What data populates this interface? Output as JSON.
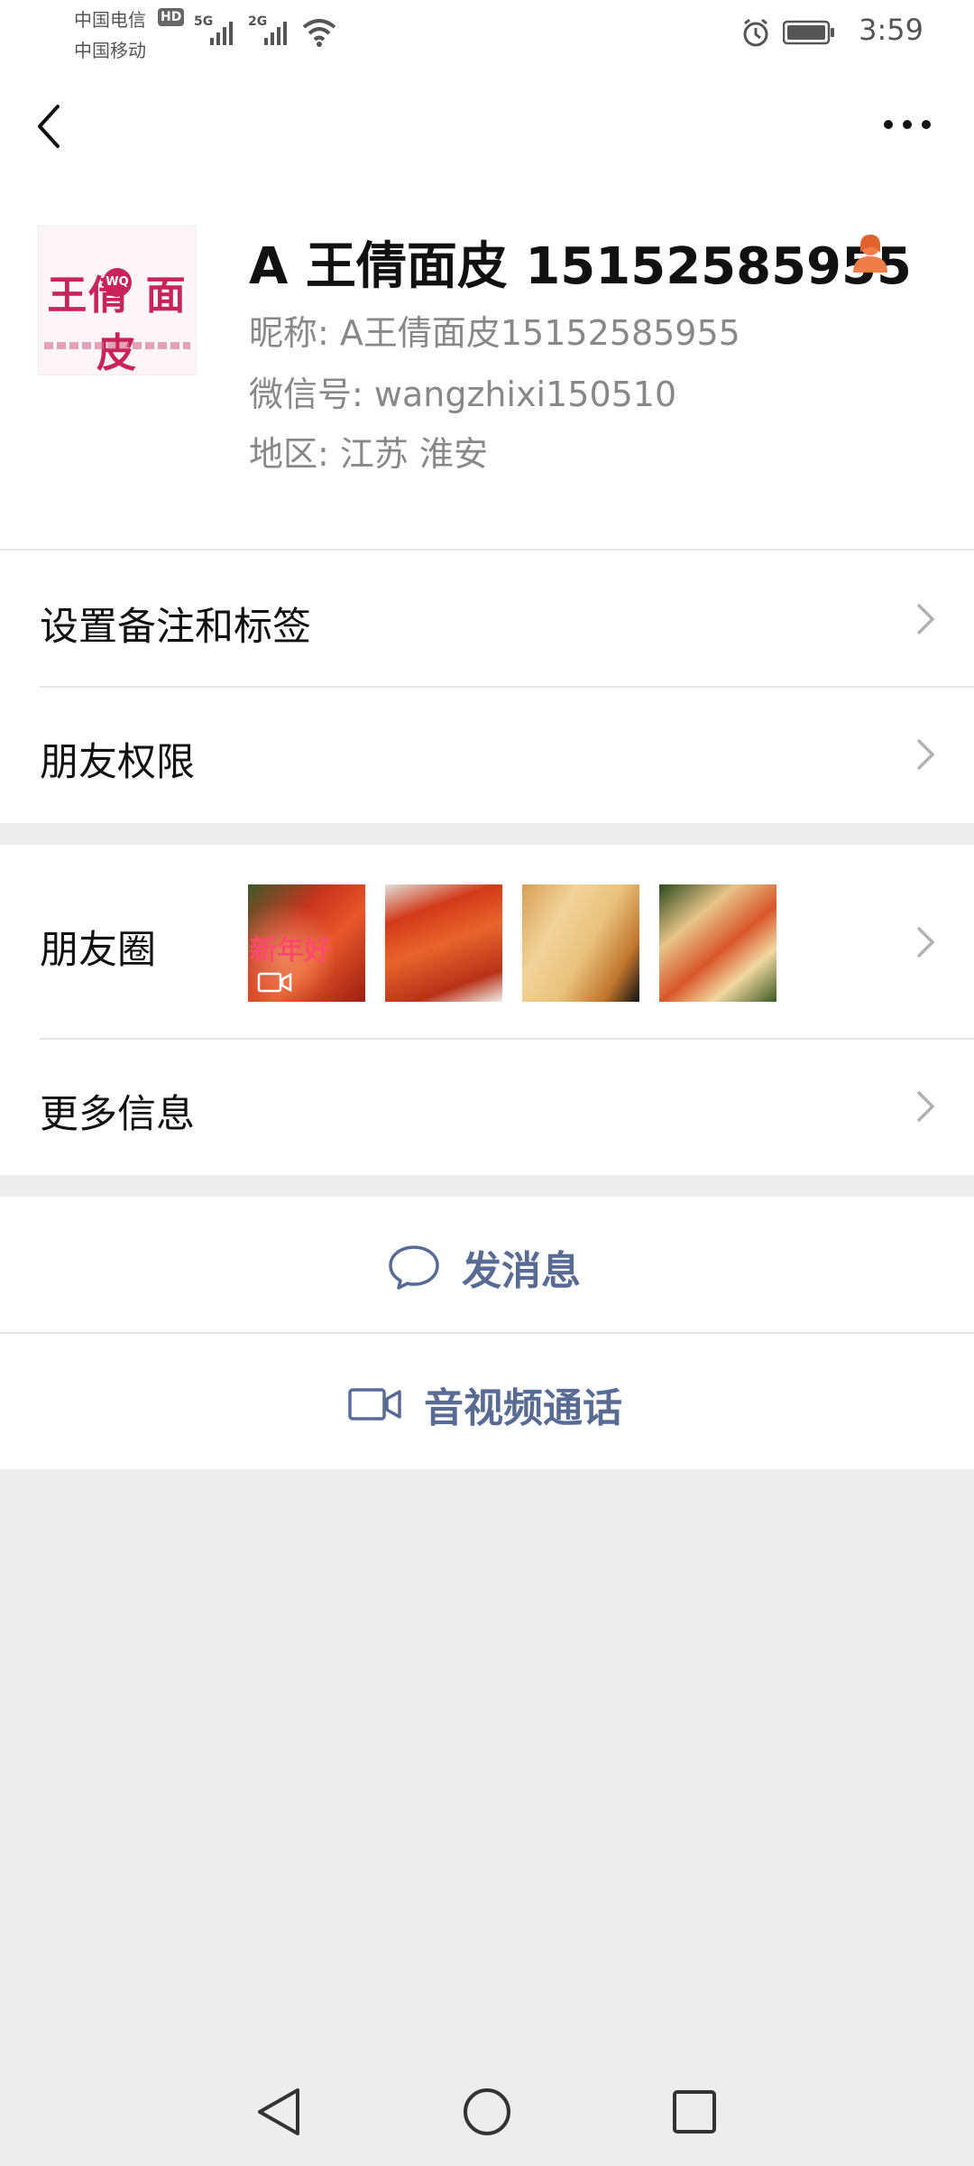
{
  "status_bar": {
    "carrier_1": "中国电信",
    "carrier_1_badge": "HD",
    "carrier_2": "中国移动",
    "signal_1_label": "5G",
    "signal_2_label": "2G",
    "time": "3:59"
  },
  "nav": {
    "back_icon": "chevron-left-icon",
    "more_icon": "more-dots-icon"
  },
  "profile": {
    "avatar_text": "王倩 面皮",
    "avatar_badge": "WQ",
    "display_name": "A 王倩面皮 15152585955",
    "gender_icon": "female-user-icon",
    "nickname": "昵称:  A王倩面皮15152585955",
    "wechat_id": "微信号:  wangzhixi150510",
    "region": "地区:  江苏  淮安"
  },
  "menu": {
    "remark_tags": "设置备注和标签",
    "friend_permissions": "朋友权限",
    "moments": "朋友圈",
    "moments_first_thumb_overlay": "新年好",
    "more_info": "更多信息"
  },
  "actions": {
    "send_message": "发消息",
    "av_call": "音视频通话"
  },
  "colors": {
    "link_blue": "#576b95",
    "gender_orange": "#f07c4a",
    "page_bg": "#ededed"
  }
}
